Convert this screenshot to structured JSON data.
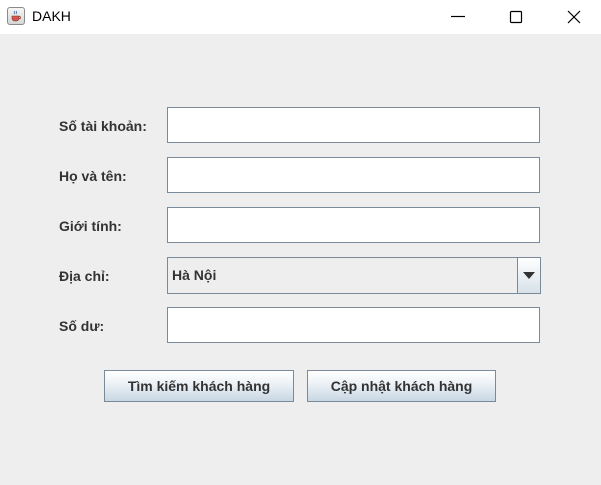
{
  "window": {
    "title": "DAKH"
  },
  "icons": {
    "app": "java-cup-icon",
    "minimize": "minimize-icon",
    "maximize": "maximize-icon",
    "close": "close-icon",
    "dropdown": "chevron-down-icon"
  },
  "form": {
    "account_number": {
      "label": "Số tài khoản:",
      "value": ""
    },
    "full_name": {
      "label": "Họ và tên:",
      "value": ""
    },
    "gender": {
      "label": "Giới tính:",
      "value": ""
    },
    "address": {
      "label": "Địa chỉ:",
      "selected": "Hà Nội"
    },
    "balance": {
      "label": "Số dư:",
      "value": ""
    }
  },
  "buttons": {
    "search_label": "Tìm kiếm khách hàng",
    "update_label": "Cập nhật khách hàng"
  },
  "colors": {
    "window_background": "#eeeeee",
    "field_border": "#7a8a99",
    "button_gradient_bottom": "#c8d7e3"
  }
}
